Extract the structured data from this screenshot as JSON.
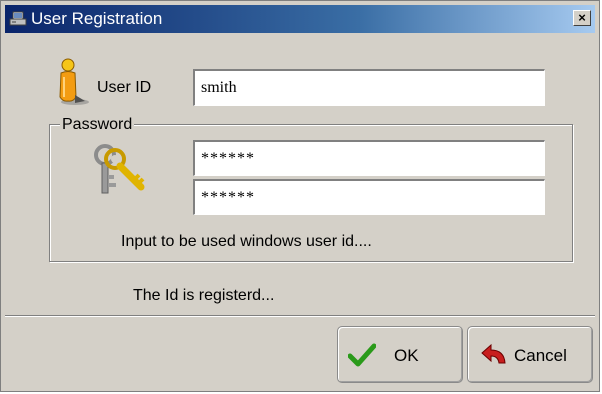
{
  "window": {
    "title": "User Registration",
    "close_glyph": "×"
  },
  "form": {
    "userid_label": "User ID",
    "userid_value": "smith",
    "password_group_label": "Password",
    "password_value": "******",
    "password_confirm_value": "******",
    "hint": "Input to be used windows user id....",
    "status": "The Id is registerd..."
  },
  "buttons": {
    "ok_label": "OK",
    "cancel_label": "Cancel"
  },
  "icons": {
    "title": "computer-icon",
    "user": "user-icon",
    "password": "keys-icon",
    "ok": "checkmark-icon",
    "cancel": "undo-arrow-icon"
  },
  "colors": {
    "titlebar_start": "#0a246a",
    "titlebar_end": "#a6caf0",
    "dialog_bg": "#d4d0c8",
    "ok_check": "#2a9a1a",
    "cancel_arrow": "#c81e1e"
  }
}
